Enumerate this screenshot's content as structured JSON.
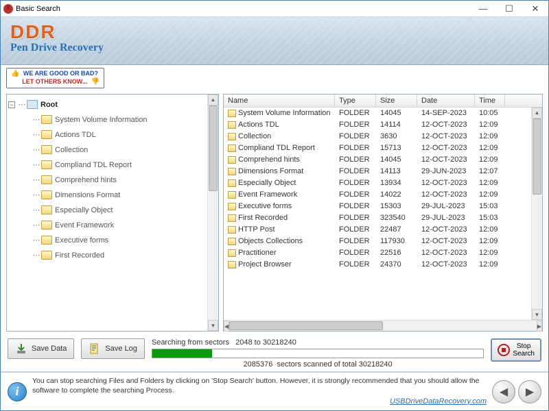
{
  "window": {
    "title": "Basic Search"
  },
  "banner": {
    "brand": "DDR",
    "subtitle": "Pen Drive Recovery"
  },
  "callout": {
    "line1": "WE ARE GOOD OR BAD?",
    "line2": "LET OTHERS KNOW..."
  },
  "tree": {
    "root": "Root",
    "items": [
      "System Volume Information",
      "Actions TDL",
      "Collection",
      "Compliand TDL Report",
      "Comprehend hints",
      "Dimensions Format",
      "Especially Object",
      "Event Framework",
      "Executive forms",
      "First Recorded"
    ]
  },
  "list": {
    "columns": {
      "name": "Name",
      "type": "Type",
      "size": "Size",
      "date": "Date",
      "time": "Time"
    },
    "rows": [
      {
        "name": "System Volume Information",
        "type": "FOLDER",
        "size": "14045",
        "date": "14-SEP-2023",
        "time": "10:05"
      },
      {
        "name": "Actions TDL",
        "type": "FOLDER",
        "size": "14114",
        "date": "12-OCT-2023",
        "time": "12:09"
      },
      {
        "name": "Collection",
        "type": "FOLDER",
        "size": "3630",
        "date": "12-OCT-2023",
        "time": "12:09"
      },
      {
        "name": "Compliand TDL Report",
        "type": "FOLDER",
        "size": "15713",
        "date": "12-OCT-2023",
        "time": "12:09"
      },
      {
        "name": "Comprehend hints",
        "type": "FOLDER",
        "size": "14045",
        "date": "12-OCT-2023",
        "time": "12:09"
      },
      {
        "name": "Dimensions Format",
        "type": "FOLDER",
        "size": "14113",
        "date": "29-JUN-2023",
        "time": "12:07"
      },
      {
        "name": "Especially Object",
        "type": "FOLDER",
        "size": "13934",
        "date": "12-OCT-2023",
        "time": "12:09"
      },
      {
        "name": "Event Framework",
        "type": "FOLDER",
        "size": "14022",
        "date": "12-OCT-2023",
        "time": "12:09"
      },
      {
        "name": "Executive forms",
        "type": "FOLDER",
        "size": "15303",
        "date": "29-JUL-2023",
        "time": "15:03"
      },
      {
        "name": "First Recorded",
        "type": "FOLDER",
        "size": "323540",
        "date": "29-JUL-2023",
        "time": "15:03"
      },
      {
        "name": "HTTP Post",
        "type": "FOLDER",
        "size": "22487",
        "date": "12-OCT-2023",
        "time": "12:09"
      },
      {
        "name": "Objects Collections",
        "type": "FOLDER",
        "size": "117930",
        "date": "12-OCT-2023",
        "time": "12:09"
      },
      {
        "name": "Practitioner",
        "type": "FOLDER",
        "size": "22516",
        "date": "12-OCT-2023",
        "time": "12:09"
      },
      {
        "name": "Project Browser",
        "type": "FOLDER",
        "size": "24370",
        "date": "12-OCT-2023",
        "time": "12:09"
      }
    ]
  },
  "buttons": {
    "save_data": "Save Data",
    "save_log": "Save Log",
    "stop_search": "Stop\nSearch"
  },
  "progress": {
    "searching_label": "Searching from sectors",
    "range": "2048 to 30218240",
    "scanned_prefix": "2085376",
    "scanned_suffix": "sectors scanned of total 30218240"
  },
  "hint": {
    "text": "You can stop searching Files and Folders by clicking on 'Stop Search' button. However, it is strongly recommended that you should allow the software to complete the searching Process.",
    "url": "USBDriveDataRecovery.com"
  }
}
